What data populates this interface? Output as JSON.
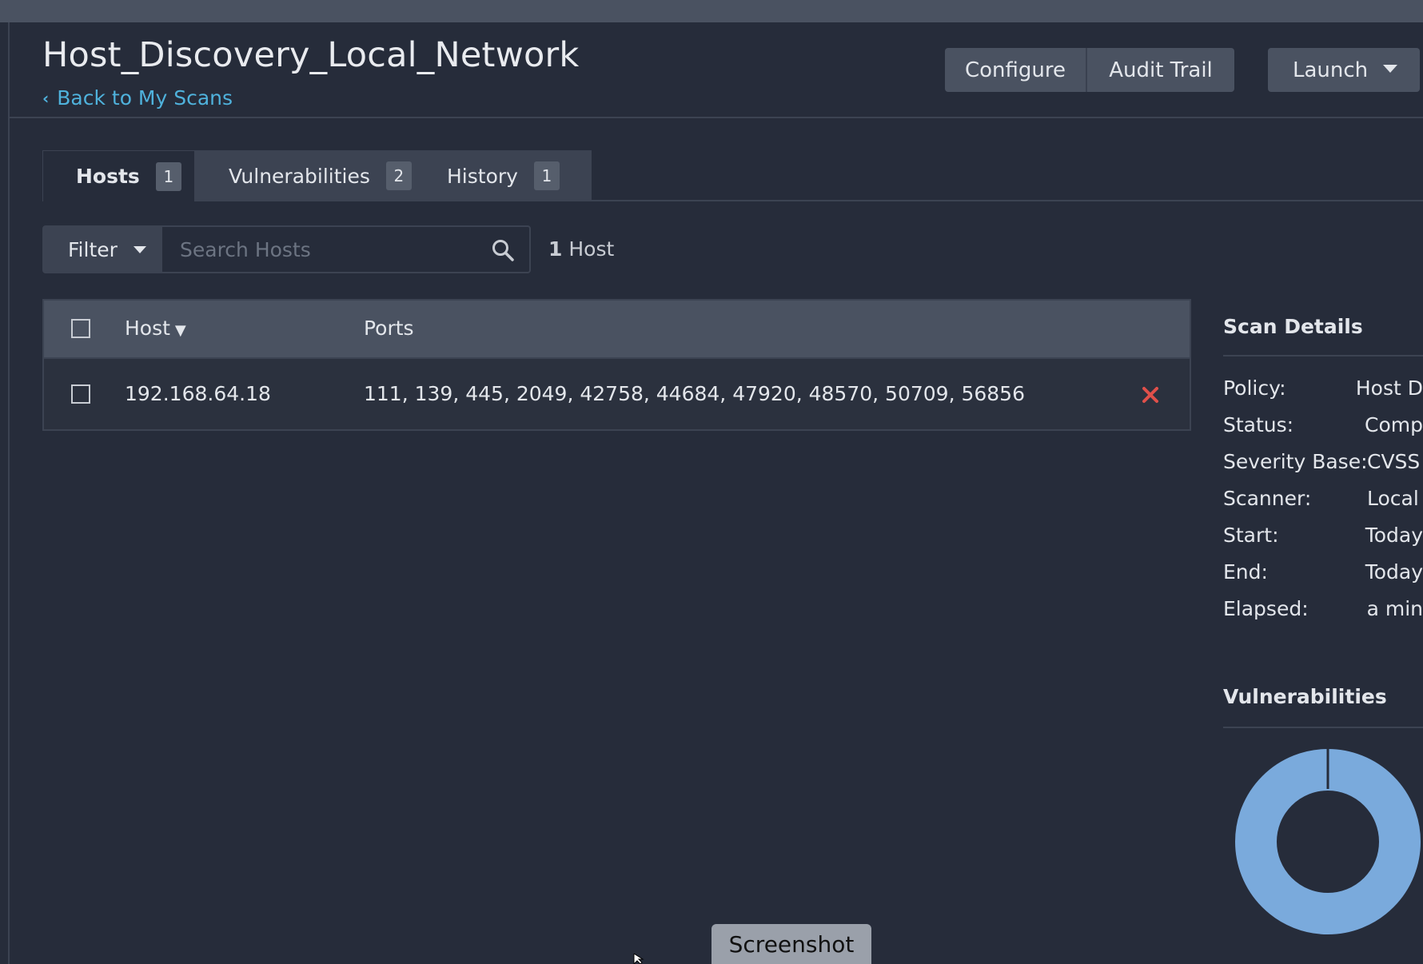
{
  "header": {
    "title": "Host_Discovery_Local_Network",
    "back_link": "Back to My Scans",
    "configure_label": "Configure",
    "audit_label": "Audit Trail",
    "launch_label": "Launch"
  },
  "tabs": [
    {
      "label": "Hosts",
      "count": "1",
      "active": true
    },
    {
      "label": "Vulnerabilities",
      "count": "2",
      "active": false
    },
    {
      "label": "History",
      "count": "1",
      "active": false
    }
  ],
  "filter": {
    "button_label": "Filter",
    "search_placeholder": "Search Hosts",
    "count_number": "1",
    "count_label": "Host"
  },
  "table": {
    "columns": [
      "Host",
      "Ports"
    ],
    "sort_indicator": "▼",
    "rows": [
      {
        "host": "192.168.64.18",
        "ports": "111, 139, 445, 2049, 42758, 44684, 47920, 48570, 50709, 56856"
      }
    ]
  },
  "scan_details": {
    "title": "Scan Details",
    "rows": [
      {
        "label": "Policy:",
        "value": "Host D"
      },
      {
        "label": "Status:",
        "value": "Comp"
      },
      {
        "label": "Severity Base:",
        "value": "CVSS v"
      },
      {
        "label": "Scanner:",
        "value": "Local"
      },
      {
        "label": "Start:",
        "value": "Today"
      },
      {
        "label": "End:",
        "value": "Today"
      },
      {
        "label": "Elapsed:",
        "value": "a min"
      }
    ]
  },
  "vulnerabilities_panel": {
    "title": "Vulnerabilities",
    "donut_color": "#7aaadc"
  },
  "screenshot_button": "Screenshot",
  "colors": {
    "background": "#262c3a",
    "accent_link": "#4fb2dc",
    "delete_red": "#e0504a"
  }
}
